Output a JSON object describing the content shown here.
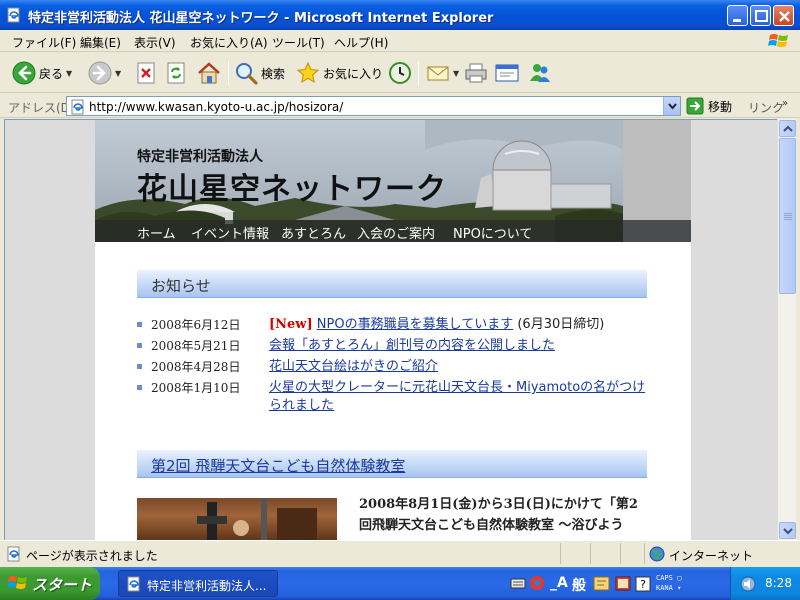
{
  "window": {
    "title": "特定非営利活動法人 花山星空ネットワーク - Microsoft Internet Explorer"
  },
  "menu": [
    "ファイル(F)",
    "編集(E)",
    "表示(V)",
    "お気に入り(A)",
    "ツール(T)",
    "ヘルプ(H)"
  ],
  "toolbar": {
    "back_label": "戻る",
    "search_label": "検索",
    "favorites_label": "お気に入り"
  },
  "address": {
    "label": "アドレス(D)",
    "url": "http://www.kwasan.kyoto-u.ac.jp/hosizora/",
    "go_label": "移動",
    "links_label": "リンク"
  },
  "site": {
    "org_name": "特定非営利活動法人",
    "title": "花山星空ネットワーク",
    "nav": [
      "ホーム",
      "イベント情報",
      "あすとろん",
      "入会のご案内",
      "NPOについて"
    ]
  },
  "news": {
    "heading": "お知らせ",
    "items": [
      {
        "date": "2008年6月12日",
        "badge": "[New]",
        "link": "NPOの事務職員を募集しています",
        "suffix": " (6月30日締切)"
      },
      {
        "date": "2008年5月21日",
        "badge": "",
        "link": "会報「あすとろん」創刊号の内容を公開しました",
        "suffix": ""
      },
      {
        "date": "2008年4月28日",
        "badge": "",
        "link": "花山天文台絵はがきのご紹介",
        "suffix": ""
      },
      {
        "date": "2008年1月10日",
        "badge": "",
        "link": "火星の大型クレーターに元花山天文台長・Miyamotoの名がつけられました",
        "suffix": ""
      }
    ]
  },
  "event": {
    "heading": "第2回 飛騨天文台こども自然体験教室",
    "text": "2008年8月1日(金)から3日(日)にかけて「第2回飛騨天文台こども自然体験教室 ～浴びよう"
  },
  "status": {
    "text": "ページが表示されました",
    "zone": "インターネット"
  },
  "taskbar": {
    "start_label": "スタート",
    "task_label": "特定非営利活動法人...",
    "ime_mode": "_A",
    "ime_conv": "般",
    "caps": "CAPS",
    "kana": "KANA",
    "clock": "8:28"
  },
  "colors": {
    "titlebar": "#0453d8",
    "link": "#1a3a9c",
    "new_badge": "#d40000",
    "section_header": "#c5d9f7"
  }
}
